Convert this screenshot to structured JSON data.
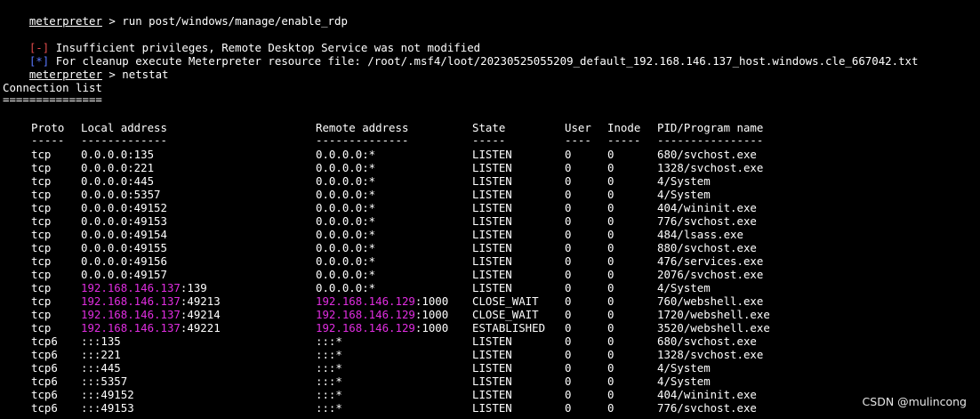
{
  "terminal": {
    "prompt_label": "meterpreter",
    "prompt_suffix": " > ",
    "cmd1": "run post/windows/manage/enable_rdp",
    "err_marker": "[-]",
    "err_text": " Insufficient privileges, Remote Desktop Service was not modified",
    "info_marker": "[*]",
    "info_text": " For cleanup execute Meterpreter resource file: /root/.msf4/loot/20230525055209_default_192.168.146.137_host.windows.cle_667042.txt",
    "cmd2": "netstat",
    "list_title": "Connection list",
    "list_underline": "==============="
  },
  "table": {
    "headers": [
      "Proto",
      "Local address",
      "Remote address",
      "State",
      "User",
      "Inode",
      "PID/Program name"
    ],
    "separators": [
      "-----",
      "-------------",
      "--------------",
      "-----",
      "----",
      "-----",
      "----------------"
    ],
    "rows": [
      {
        "proto": "tcp",
        "local_ip": "",
        "local": "0.0.0.0:135",
        "remote_ip": "",
        "remote": "0.0.0.0:*",
        "state": "LISTEN",
        "user": "0",
        "inode": "0",
        "pid": "680/svchost.exe"
      },
      {
        "proto": "tcp",
        "local_ip": "",
        "local": "0.0.0.0:221",
        "remote_ip": "",
        "remote": "0.0.0.0:*",
        "state": "LISTEN",
        "user": "0",
        "inode": "0",
        "pid": "1328/svchost.exe"
      },
      {
        "proto": "tcp",
        "local_ip": "",
        "local": "0.0.0.0:445",
        "remote_ip": "",
        "remote": "0.0.0.0:*",
        "state": "LISTEN",
        "user": "0",
        "inode": "0",
        "pid": "4/System"
      },
      {
        "proto": "tcp",
        "local_ip": "",
        "local": "0.0.0.0:5357",
        "remote_ip": "",
        "remote": "0.0.0.0:*",
        "state": "LISTEN",
        "user": "0",
        "inode": "0",
        "pid": "4/System"
      },
      {
        "proto": "tcp",
        "local_ip": "",
        "local": "0.0.0.0:49152",
        "remote_ip": "",
        "remote": "0.0.0.0:*",
        "state": "LISTEN",
        "user": "0",
        "inode": "0",
        "pid": "404/wininit.exe"
      },
      {
        "proto": "tcp",
        "local_ip": "",
        "local": "0.0.0.0:49153",
        "remote_ip": "",
        "remote": "0.0.0.0:*",
        "state": "LISTEN",
        "user": "0",
        "inode": "0",
        "pid": "776/svchost.exe"
      },
      {
        "proto": "tcp",
        "local_ip": "",
        "local": "0.0.0.0:49154",
        "remote_ip": "",
        "remote": "0.0.0.0:*",
        "state": "LISTEN",
        "user": "0",
        "inode": "0",
        "pid": "484/lsass.exe"
      },
      {
        "proto": "tcp",
        "local_ip": "",
        "local": "0.0.0.0:49155",
        "remote_ip": "",
        "remote": "0.0.0.0:*",
        "state": "LISTEN",
        "user": "0",
        "inode": "0",
        "pid": "880/svchost.exe"
      },
      {
        "proto": "tcp",
        "local_ip": "",
        "local": "0.0.0.0:49156",
        "remote_ip": "",
        "remote": "0.0.0.0:*",
        "state": "LISTEN",
        "user": "0",
        "inode": "0",
        "pid": "476/services.exe"
      },
      {
        "proto": "tcp",
        "local_ip": "",
        "local": "0.0.0.0:49157",
        "remote_ip": "",
        "remote": "0.0.0.0:*",
        "state": "LISTEN",
        "user": "0",
        "inode": "0",
        "pid": "2076/svchost.exe"
      },
      {
        "proto": "tcp",
        "local_ip": "192.168.146.137",
        "local": ":139",
        "remote_ip": "",
        "remote": "0.0.0.0:*",
        "state": "LISTEN",
        "user": "0",
        "inode": "0",
        "pid": "4/System"
      },
      {
        "proto": "tcp",
        "local_ip": "192.168.146.137",
        "local": ":49213",
        "remote_ip": "192.168.146.129",
        "remote": ":1000",
        "state": "CLOSE_WAIT",
        "user": "0",
        "inode": "0",
        "pid": "760/webshell.exe"
      },
      {
        "proto": "tcp",
        "local_ip": "192.168.146.137",
        "local": ":49214",
        "remote_ip": "192.168.146.129",
        "remote": ":1000",
        "state": "CLOSE_WAIT",
        "user": "0",
        "inode": "0",
        "pid": "1720/webshell.exe"
      },
      {
        "proto": "tcp",
        "local_ip": "192.168.146.137",
        "local": ":49221",
        "remote_ip": "192.168.146.129",
        "remote": ":1000",
        "state": "ESTABLISHED",
        "user": "0",
        "inode": "0",
        "pid": "3520/webshell.exe"
      },
      {
        "proto": "tcp6",
        "local_ip": "",
        "local": ":::135",
        "remote_ip": "",
        "remote": ":::*",
        "state": "LISTEN",
        "user": "0",
        "inode": "0",
        "pid": "680/svchost.exe"
      },
      {
        "proto": "tcp6",
        "local_ip": "",
        "local": ":::221",
        "remote_ip": "",
        "remote": ":::*",
        "state": "LISTEN",
        "user": "0",
        "inode": "0",
        "pid": "1328/svchost.exe"
      },
      {
        "proto": "tcp6",
        "local_ip": "",
        "local": ":::445",
        "remote_ip": "",
        "remote": ":::*",
        "state": "LISTEN",
        "user": "0",
        "inode": "0",
        "pid": "4/System"
      },
      {
        "proto": "tcp6",
        "local_ip": "",
        "local": ":::5357",
        "remote_ip": "",
        "remote": ":::*",
        "state": "LISTEN",
        "user": "0",
        "inode": "0",
        "pid": "4/System"
      },
      {
        "proto": "tcp6",
        "local_ip": "",
        "local": ":::49152",
        "remote_ip": "",
        "remote": ":::*",
        "state": "LISTEN",
        "user": "0",
        "inode": "0",
        "pid": "404/wininit.exe"
      },
      {
        "proto": "tcp6",
        "local_ip": "",
        "local": ":::49153",
        "remote_ip": "",
        "remote": ":::*",
        "state": "LISTEN",
        "user": "0",
        "inode": "0",
        "pid": "776/svchost.exe"
      }
    ]
  },
  "watermark": "CSDN @mulincong",
  "colors": {
    "background": "#000000",
    "text": "#ffffff",
    "error_marker": "#e24b4b",
    "info_marker": "#5a79ff",
    "ip_highlight": "#e02de0"
  }
}
